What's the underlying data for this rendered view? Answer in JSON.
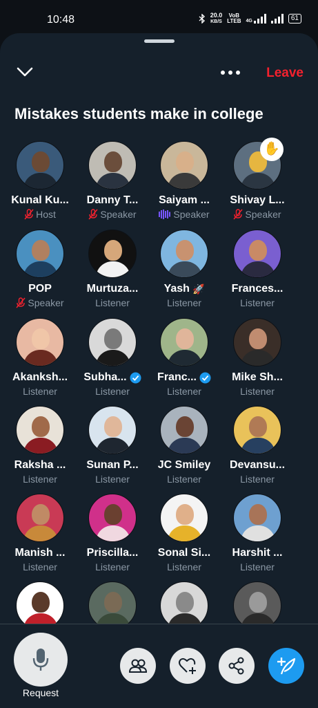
{
  "status_bar": {
    "time": "10:48",
    "speed": "20.0",
    "speed_unit": "KB/S",
    "volte_top": "VoB",
    "volte_bottom": "LTEB",
    "network": "4G",
    "battery": "61"
  },
  "header": {
    "leave_label": "Leave",
    "accent_color": "#f4212e"
  },
  "space": {
    "title": "Mistakes students make in college"
  },
  "participants": [
    {
      "name": "Kunal Ku...",
      "role": "Host",
      "mic": "muted",
      "colors": [
        "#3a5a7a",
        "#6b4a35",
        "#1c2733"
      ]
    },
    {
      "name": "Danny T...",
      "role": "Speaker",
      "mic": "muted",
      "colors": [
        "#bfbcb4",
        "#6b4e3c",
        "#2a3340"
      ]
    },
    {
      "name": "Saiyam ...",
      "role": "Speaker",
      "mic": "speaking",
      "colors": [
        "#c9b79a",
        "#d8b08a",
        "#3a3a3a"
      ]
    },
    {
      "name": "Shivay L...",
      "role": "Speaker",
      "mic": "muted",
      "raised_hand": "✋",
      "colors": [
        "#5d6f80",
        "#e6b640",
        "#2b3642"
      ]
    },
    {
      "name": "POP",
      "role": "Speaker",
      "mic": "muted",
      "colors": [
        "#4a90c0",
        "#b08060",
        "#1d3f5f"
      ]
    },
    {
      "name": "Murtuza...",
      "role": "Listener",
      "colors": [
        "#111111",
        "#d6a77a",
        "#f2f2f2"
      ]
    },
    {
      "name": "Yash",
      "name_emoji": "🚀",
      "role": "Listener",
      "colors": [
        "#7fb6e0",
        "#c89270",
        "#3a4a5a"
      ]
    },
    {
      "name": "Frances...",
      "role": "Listener",
      "colors": [
        "#7a5fd0",
        "#c98a65",
        "#2a2a40"
      ]
    },
    {
      "name": "Akanksh...",
      "role": "Listener",
      "colors": [
        "#e8b9a3",
        "#f0c6a8",
        "#6a2a20"
      ]
    },
    {
      "name": "Subha...",
      "role": "Listener",
      "verified": true,
      "colors": [
        "#d9d9d9",
        "#7a7a7a",
        "#1a1a1a"
      ]
    },
    {
      "name": "Franc...",
      "role": "Listener",
      "verified": true,
      "colors": [
        "#9fb58a",
        "#e0b59a",
        "#1f2a33"
      ]
    },
    {
      "name": "Mike Sh...",
      "role": "Listener",
      "colors": [
        "#3a2e28",
        "#c08c70",
        "#2a2a2a"
      ]
    },
    {
      "name": "Raksha ...",
      "role": "Listener",
      "colors": [
        "#e8e2d8",
        "#a06a4a",
        "#8a1c22"
      ]
    },
    {
      "name": "Sunan P...",
      "role": "Listener",
      "colors": [
        "#d8e4ee",
        "#e0b79a",
        "#1e2630"
      ]
    },
    {
      "name": "JC Smiley",
      "role": "Listener",
      "colors": [
        "#a9b3bd",
        "#6a4434",
        "#2b3a55"
      ]
    },
    {
      "name": "Devansu...",
      "role": "Listener",
      "colors": [
        "#e9c25a",
        "#b07a55",
        "#274060"
      ]
    },
    {
      "name": "Manish ...",
      "role": "Listener",
      "colors": [
        "#c93a55",
        "#c08a65",
        "#c8893a"
      ]
    },
    {
      "name": "Priscilla...",
      "role": "Listener",
      "colors": [
        "#d0308a",
        "#6a4030",
        "#f0d8e0"
      ]
    },
    {
      "name": "Sonal Si...",
      "role": "Listener",
      "colors": [
        "#f4f4f4",
        "#e0b08a",
        "#e6b22a"
      ]
    },
    {
      "name": "Harshit ...",
      "role": "Listener",
      "colors": [
        "#6ea0d0",
        "#a87458",
        "#e0e0e0"
      ]
    },
    {
      "name": "",
      "role": "",
      "colors": [
        "#ffffff",
        "#5a3a2a",
        "#c0202a"
      ]
    },
    {
      "name": "",
      "role": "",
      "colors": [
        "#5a6a60",
        "#7a6a55",
        "#3a4a3a"
      ]
    },
    {
      "name": "",
      "role": "",
      "colors": [
        "#d8d8d8",
        "#8a8a8a",
        "#2a2a2a"
      ]
    },
    {
      "name": "",
      "role": "",
      "colors": [
        "#5a5a5a",
        "#9a9a9a",
        "#2a2a2a"
      ]
    }
  ],
  "bottom_bar": {
    "request_label": "Request",
    "compose_color": "#1d9bf0"
  },
  "icons": {
    "collapse": "chevron-down-icon",
    "more": "more-icon",
    "mic": "microphone-icon",
    "people": "people-icon",
    "react": "heart-plus-icon",
    "share": "share-icon",
    "compose": "compose-icon"
  }
}
